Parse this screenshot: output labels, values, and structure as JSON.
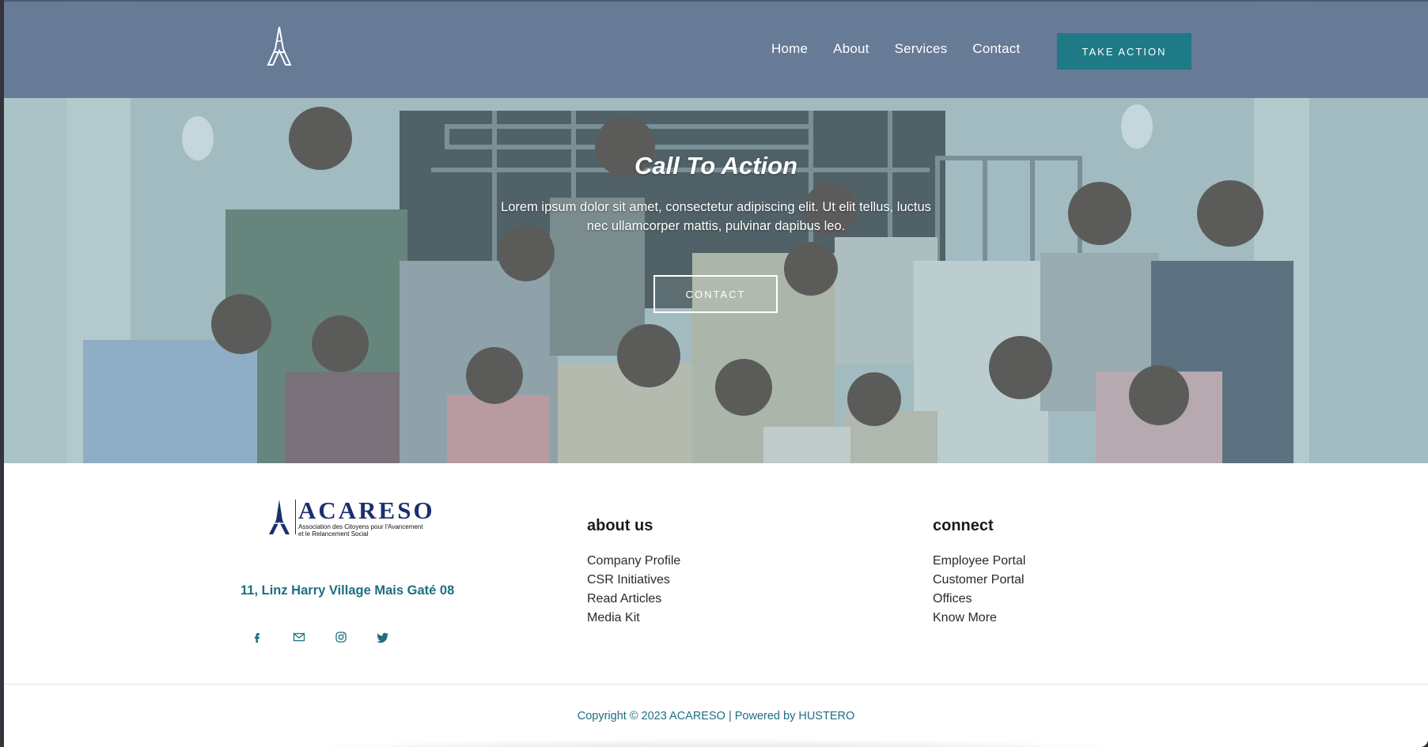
{
  "header": {
    "nav": [
      "Home",
      "About",
      "Services",
      "Contact"
    ],
    "take_action": "TAKE ACTION"
  },
  "cta": {
    "title": "Call To Action",
    "text": "Lorem ipsum dolor sit amet, consectetur adipiscing elit. Ut elit tellus, luctus nec ullamcorper mattis, pulvinar dapibus leo.",
    "button": "CONTACT"
  },
  "footer": {
    "brand": {
      "name": "ACARESO",
      "tagline_line1": "Association des Citoyens pour l'Avancement",
      "tagline_line2": "et le Relancement Social"
    },
    "address": "11, Linz Harry Village Mais Gaté 08",
    "socials": [
      "facebook-icon",
      "mail-icon",
      "instagram-icon",
      "twitter-icon"
    ],
    "about": {
      "title": "about us",
      "items": [
        "Company Profile",
        "CSR Initiatives",
        "Read Articles",
        "Media Kit"
      ]
    },
    "connect": {
      "title": "connect",
      "items": [
        "Employee Portal",
        "Customer Portal",
        "Offices",
        "Know More"
      ]
    },
    "copyright": "Copyright © 2023 ACARESO | Powered by HUSTERO"
  },
  "colors": {
    "accent": "#1e7a86",
    "header_bg": "#627592",
    "brand_navy": "#1b2f6e",
    "link_teal": "#1e6e80"
  }
}
